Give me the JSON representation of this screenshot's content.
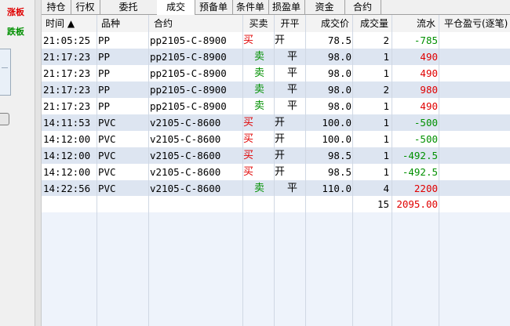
{
  "side_panel": {
    "limit_up": "涨板",
    "limit_down": "跌板",
    "colors": {
      "up": "#e00000",
      "down": "#009000"
    }
  },
  "tabs": [
    "持仓",
    "行权",
    "委托",
    "成交",
    "预备单",
    "条件单",
    "损盈单",
    "资金",
    "合约"
  ],
  "active_tab": "成交",
  "columns": [
    "时间 ▲",
    "品种",
    "合约",
    "买卖",
    "开平",
    "成交价",
    "成交量",
    "流水",
    "平仓盈亏(逐笔)"
  ],
  "rows": [
    {
      "time": "21:05:25",
      "variety": "PP",
      "contract": "pp2105-C-8900",
      "side": "买",
      "open_close": "开",
      "price": "78.5",
      "qty": "2",
      "flow": "-785",
      "flow_color": "green"
    },
    {
      "time": "21:17:23",
      "variety": "PP",
      "contract": "pp2105-C-8900",
      "side": "卖",
      "open_close": "平",
      "price": "98.0",
      "qty": "1",
      "flow": "490",
      "flow_color": "red"
    },
    {
      "time": "21:17:23",
      "variety": "PP",
      "contract": "pp2105-C-8900",
      "side": "卖",
      "open_close": "平",
      "price": "98.0",
      "qty": "1",
      "flow": "490",
      "flow_color": "red"
    },
    {
      "time": "21:17:23",
      "variety": "PP",
      "contract": "pp2105-C-8900",
      "side": "卖",
      "open_close": "平",
      "price": "98.0",
      "qty": "2",
      "flow": "980",
      "flow_color": "red"
    },
    {
      "time": "21:17:23",
      "variety": "PP",
      "contract": "pp2105-C-8900",
      "side": "卖",
      "open_close": "平",
      "price": "98.0",
      "qty": "1",
      "flow": "490",
      "flow_color": "red"
    },
    {
      "time": "14:11:53",
      "variety": "PVC",
      "contract": "v2105-C-8600",
      "side": "买",
      "open_close": "开",
      "price": "100.0",
      "qty": "1",
      "flow": "-500",
      "flow_color": "green"
    },
    {
      "time": "14:12:00",
      "variety": "PVC",
      "contract": "v2105-C-8600",
      "side": "买",
      "open_close": "开",
      "price": "100.0",
      "qty": "1",
      "flow": "-500",
      "flow_color": "green"
    },
    {
      "time": "14:12:00",
      "variety": "PVC",
      "contract": "v2105-C-8600",
      "side": "买",
      "open_close": "开",
      "price": "98.5",
      "qty": "1",
      "flow": "-492.5",
      "flow_color": "green"
    },
    {
      "time": "14:12:00",
      "variety": "PVC",
      "contract": "v2105-C-8600",
      "side": "买",
      "open_close": "开",
      "price": "98.5",
      "qty": "1",
      "flow": "-492.5",
      "flow_color": "green"
    },
    {
      "time": "14:22:56",
      "variety": "PVC",
      "contract": "v2105-C-8600",
      "side": "卖",
      "open_close": "平",
      "price": "110.0",
      "qty": "4",
      "flow": "2200",
      "flow_color": "red"
    }
  ],
  "totals": {
    "qty": "15",
    "flow": "2095.00"
  },
  "colors": {
    "buy": "#e00000",
    "sell": "#009000",
    "row_alt": "#dde5f1"
  }
}
